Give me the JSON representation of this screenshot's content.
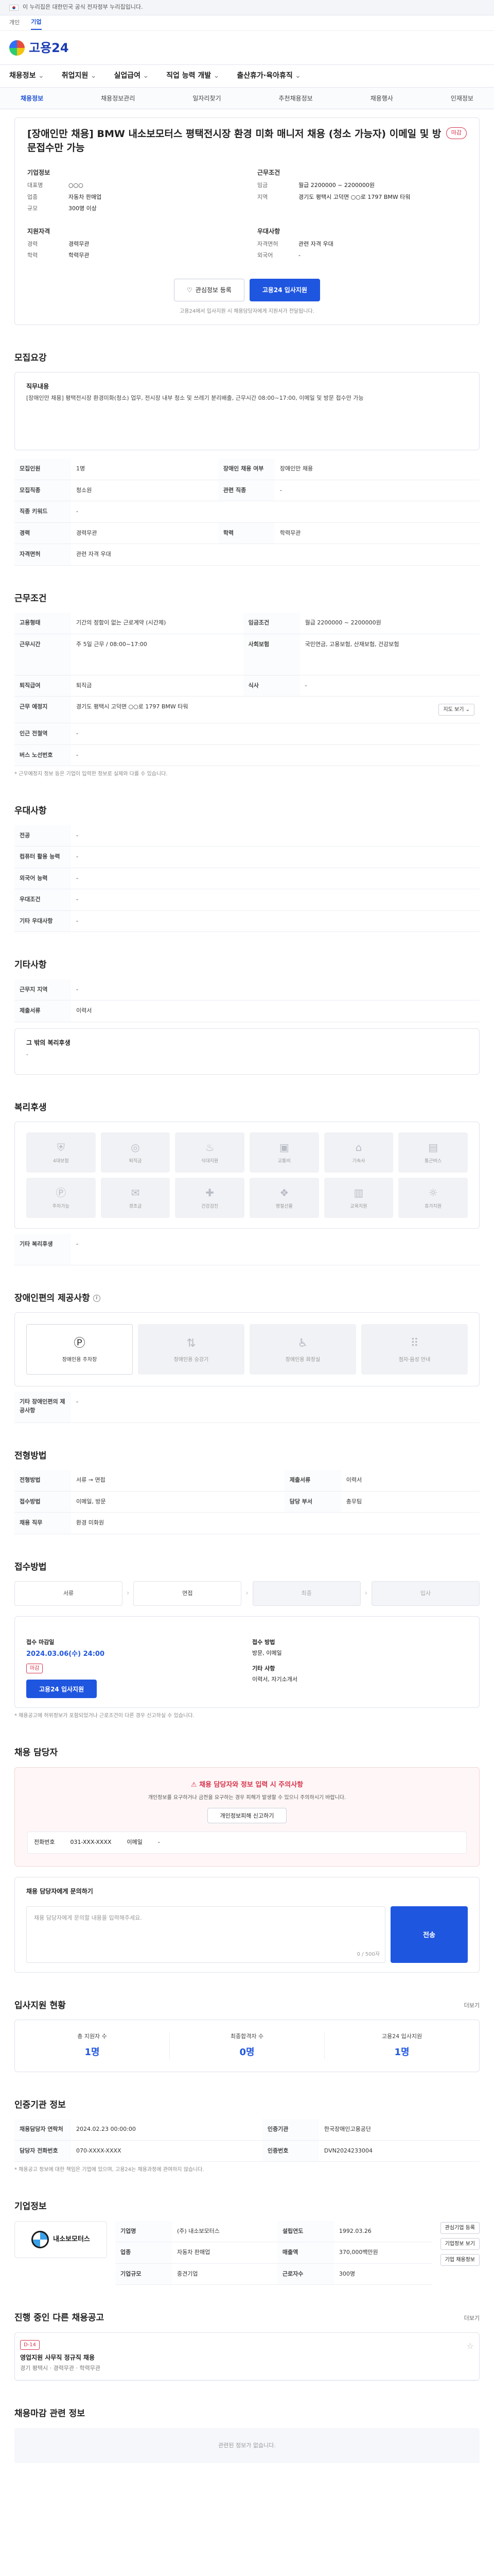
{
  "gov": {
    "notice": "이 누리집은 대한민국 공식 전자정부 누리집입니다."
  },
  "lang": [
    "개인",
    "기업"
  ],
  "brand": {
    "name": "고용24"
  },
  "gnb": [
    "채용정보",
    "취업지원",
    "실업급여",
    "직업 능력 개발",
    "출산휴가·육아휴직"
  ],
  "subtabs": [
    "채용정보",
    "채용정보관리",
    "일자리찾기",
    "추천채용정보",
    "채용행사",
    "인재정보"
  ],
  "job": {
    "title": "[장애인만 채용] BMW 내소보모터스 평택전시장 환경 미화 매니저 채용 (청소 가능자) 이메일 및 방문접수만 가능",
    "status": "마감",
    "company_h": "기업정보",
    "company": [
      [
        "대표명",
        "○○○"
      ],
      [
        "업종",
        "자동차 판매업"
      ],
      [
        "규모",
        "300명 이상"
      ]
    ],
    "work_h": "근무조건",
    "work": [
      [
        "임금",
        "월급 2200000 ~ 2200000원"
      ],
      [
        "지역",
        "경기도 평택시 고덕면 ○○로 1797 BMW 타워"
      ]
    ],
    "req_h": "지원자격",
    "req": [
      [
        "경력",
        "경력무관"
      ],
      [
        "학력",
        "학력무관"
      ]
    ],
    "prefer_h": "우대사항",
    "prefer": [
      [
        "자격면허",
        "관련 자격 우대"
      ],
      [
        "외국어",
        "-"
      ]
    ],
    "btn_scrap": "관심정보 등록",
    "btn_apply": "고용24 입사지원",
    "notice": "고용24에서 입사지원 시 채용담당자에게 지원서가 전달됩니다."
  },
  "recruit": {
    "title": "모집요강",
    "desc_h": "직무내용",
    "desc": "[장애인만 채용] 평택전시장 환경미화(청소) 업무, 전시장 내부 청소 및 쓰레기 분리배출, 근무시간 08:00~17:00, 이메일 및 방문 접수만 가능",
    "rows": [
      [
        "모집인원",
        "1명",
        "장애인 채용 여부",
        "장애인만 채용"
      ],
      [
        "모집직종",
        "청소원",
        "관련 직종",
        "-"
      ],
      [
        "직종 키워드",
        "-",
        "",
        ""
      ],
      [
        "경력",
        "경력무관",
        "학력",
        "학력무관"
      ],
      [
        "자격면허",
        "관련 자격 우대",
        "",
        ""
      ]
    ]
  },
  "condition": {
    "title": "근무조건",
    "rows": [
      [
        "고용형태",
        "기간의 정함이 없는 근로계약 (시간제)",
        "임금조건",
        "월급 2200000 ~ 2200000원"
      ],
      [
        "근무시간",
        "주 5일 근무 / 08:00~17:00",
        "사회보험",
        "국민연금, 고용보험, 산재보험, 건강보험"
      ],
      [
        "퇴직급여",
        "퇴직금",
        "식사",
        "-"
      ],
      [
        "근무 예정지",
        "경기도 평택시 고덕면 ○○로 1797 BMW 타워",
        "",
        ""
      ],
      [
        "인근 전철역",
        "-",
        "",
        ""
      ],
      [
        "버스 노선번호",
        "-",
        "",
        ""
      ]
    ],
    "note": "* 근무예정지 정보 등은 기업이 입력한 정보로 실제와 다를 수 있습니다."
  },
  "prefer2": {
    "title": "우대사항",
    "rows": [
      [
        "전공",
        "-"
      ],
      [
        "컴퓨터 활용 능력",
        "-"
      ],
      [
        "외국어 능력",
        "-"
      ],
      [
        "우대조건",
        "-"
      ],
      [
        "기타 우대사항",
        "-"
      ]
    ]
  },
  "other": {
    "title": "기타사항",
    "rows": [
      [
        "근무지 지역",
        "-"
      ],
      [
        "제출서류",
        "이력서"
      ]
    ],
    "extra_h": "그 밖의 복리후생",
    "extra": "-"
  },
  "welfare": {
    "title": "복리후생",
    "items": [
      "4대보험",
      "퇴직금",
      "식대지원",
      "교통비",
      "기숙사",
      "통근버스",
      "주차가능",
      "경조금",
      "건강검진",
      "명절선물",
      "교육지원",
      "휴가지원"
    ],
    "extra_h": "기타 복리후생",
    "extra": "-"
  },
  "disability": {
    "title": "장애인편의 제공사항",
    "items": [
      "장애인용 주차장",
      "장애인용 승강기",
      "장애인용 화장실",
      "점자·음성 안내"
    ],
    "extra_h": "기타 장애인편의 제공사항",
    "extra": "-"
  },
  "process": {
    "title": "전형방법",
    "rows": [
      [
        "전형방법",
        "서류 → 면접",
        "제출서류",
        "이력서"
      ],
      [
        "접수방법",
        "이메일, 방문",
        "담당 부서",
        "총무팀"
      ],
      [
        "채용 직무",
        "환경 미화원",
        "",
        ""
      ]
    ],
    "steps": [
      "서류",
      "면접",
      "최종",
      "입사"
    ]
  },
  "apply": {
    "title": "접수방법",
    "deadline_h": "접수 마감일",
    "deadline": "2024.03.06(수) 24:00",
    "status": "마감",
    "method_h": "접수 방법",
    "method": "방문, 이메일",
    "etc_h": "기타 사항",
    "etc": "이력서, 자기소개서",
    "btn": "고용24 입사지원",
    "note": "* 채용공고에 허위정보가 포함되었거나 근로조건이 다른 경우 신고하실 수 있습니다."
  },
  "report": {
    "title": "채용 담당자",
    "warn_h": "채용 담당자와 정보 입력 시 주의사항",
    "warn_p": "개인정보를 요구하거나 금전을 요구하는 경우 피해가 발생할 수 있으니 주의하시기 바랍니다.",
    "btn": "개인정보피해 신고하기",
    "phone_h": "전화번호",
    "phone": "031-XXX-XXXX",
    "email_h": "이메일",
    "email": "-"
  },
  "inquiry": {
    "title": "채용 담당자에게 문의하기",
    "placeholder": "채용 담당자에게 문의할 내용을 입력해주세요.",
    "count": "0 / 500자",
    "send": "전송"
  },
  "stats": {
    "title": "입사지원 현황",
    "more": "더보기",
    "items": [
      [
        "총 지원자 수",
        "1명"
      ],
      [
        "최종합격자 수",
        "0명"
      ],
      [
        "고용24 입사지원",
        "1명"
      ]
    ]
  },
  "manager": {
    "title": "인증기관 정보",
    "rows": [
      [
        "채용담당자 연락처",
        "2024.02.23 00:00:00",
        "인증기관",
        "한국장애인고용공단"
      ],
      [
        "담당자 전화번호",
        "070-XXXX-XXXX",
        "인증번호",
        "DVN2024233004"
      ]
    ],
    "note": "* 채용공고 정보에 대한 책임은 기업에 있으며, 고용24는 채용과정에 관여하지 않습니다."
  },
  "company": {
    "title": "기업정보",
    "logo": "내소보모터스",
    "rows": [
      [
        "기업명",
        "(주) 내소보모터스",
        "설립연도",
        "1992.03.26"
      ],
      [
        "업종",
        "자동차 판매업",
        "매출액",
        "370,000백만원"
      ],
      [
        "기업규모",
        "중견기업",
        "근로자수",
        "300명"
      ]
    ],
    "btns": [
      "관심기업 등록",
      "기업정보 보기",
      "기업 채용정보"
    ]
  },
  "others": {
    "title": "진행 중인 다른 채용공고",
    "more": "더보기",
    "items": [
      {
        "title": "영업지원 사무직 정규직 채용",
        "info": "경기 평택시 · 경력무관 · 학력무관",
        "dday": "D-14"
      }
    ]
  },
  "nearby": {
    "title": "채용마감 관련 정보",
    "empty": "관련된 정보가 없습니다."
  }
}
